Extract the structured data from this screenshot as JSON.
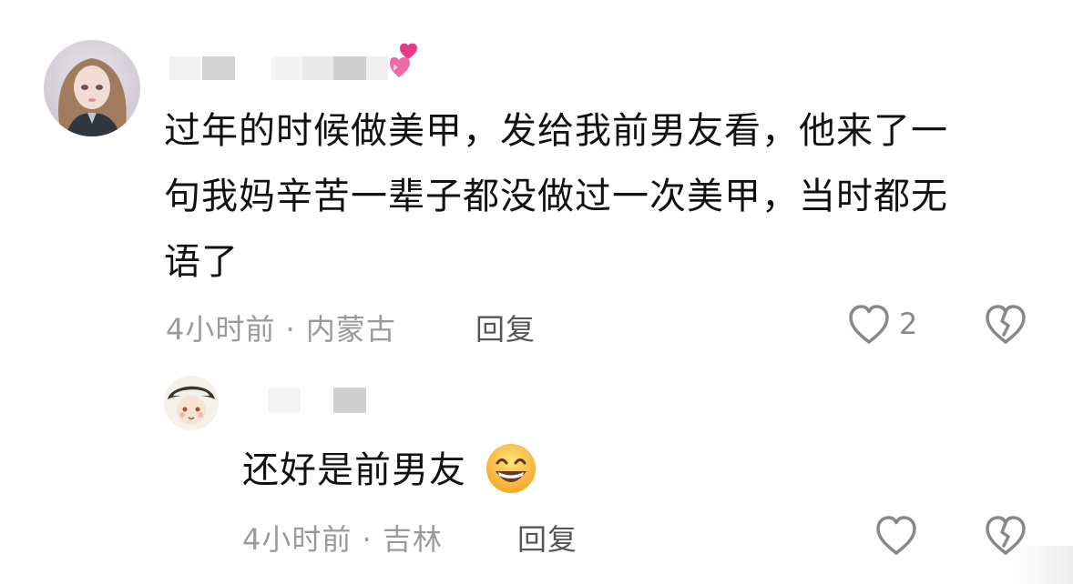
{
  "comment": {
    "text_line1": "过年的时候做美甲，发给我前男友看，他来了一",
    "text_line2": "句我妈辛苦一辈子都没做过一次美甲，当时都无",
    "text_line3": "语了",
    "time_location": "4小时前 · 内蒙古",
    "reply_label": "回复",
    "like_count": "2",
    "username_emoji_icon": "two-hearts-icon"
  },
  "reply": {
    "text": "还好是前男友",
    "emoji_icon": "grinning-face-icon",
    "time_location": "4小时前 · 吉林",
    "reply_label": "回复"
  },
  "colors": {
    "text": "#111111",
    "meta": "#9a9a9a",
    "icon": "#888888"
  }
}
